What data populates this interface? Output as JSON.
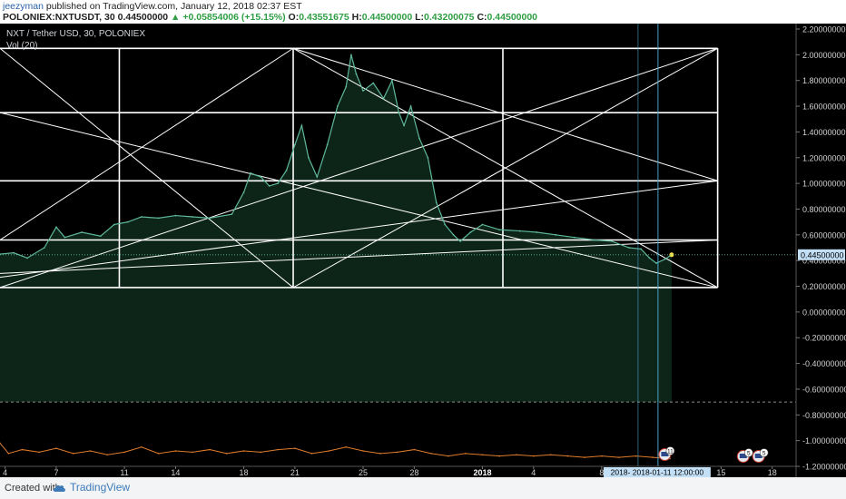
{
  "header": {
    "author": "jeezyman",
    "published_text": "published on TradingView.com, January 12, 2018 02:37 EST",
    "symbol_interval": "POLONIEX:NXTUSDT, 30",
    "price": "0.44500000",
    "change_arrow": "▲",
    "change": "+0.05854006 (+15.15%)",
    "o_label": "O:",
    "o_value": "0.43551675",
    "h_label": "H:",
    "h_value": "0.44500000",
    "l_label": "L:",
    "l_value": "0.43200075",
    "c_label": "C:",
    "c_value": "0.44500000"
  },
  "legend": {
    "title": "NXT / Tether USD, 30, POLONIEX",
    "vol": "Vol (20)"
  },
  "footer": {
    "created": "Created with",
    "brand": "TradingView"
  },
  "badges": {
    "flag_1": "11",
    "flag_2": "5",
    "flag_3": "5"
  },
  "colors": {
    "background": "#000000",
    "price_line": "#5fb89b",
    "drawing": "#ffffff",
    "volume": "#e07b2a",
    "price_tag": "#c3dff5",
    "crosshair": "#4aa3c8",
    "brand": "#3d7ab8"
  },
  "chart_data": {
    "type": "line",
    "title": "NXT / Tether USD, 30, POLONIEX",
    "ylim": [
      -1.2,
      2.2
    ],
    "yticks": [
      2.2,
      2.0,
      1.8,
      1.6,
      1.4,
      1.2,
      1.0,
      0.8,
      0.6,
      0.4,
      0.2,
      0.0,
      -0.2,
      -0.4,
      -0.6,
      -0.8,
      -1.0,
      -1.2
    ],
    "ytick_labels": [
      "2.20000000",
      "2.00000000",
      "1.80000000",
      "1.60000000",
      "1.40000000",
      "1.20000000",
      "1.00000000",
      "0.80000000",
      "0.60000000",
      "0.40000000",
      "0.20000000",
      "0.00000000",
      "-0.20000000",
      "-0.40000000",
      "-0.60000000",
      "-0.80000000",
      "-1.00000000",
      "-1.20000000"
    ],
    "xlim": [
      3.7,
      50.4
    ],
    "xticks": [
      {
        "x": 4,
        "label": "4"
      },
      {
        "x": 7,
        "label": "7"
      },
      {
        "x": 11,
        "label": "11"
      },
      {
        "x": 14,
        "label": "14"
      },
      {
        "x": 18,
        "label": "18"
      },
      {
        "x": 21,
        "label": "21"
      },
      {
        "x": 25,
        "label": "25"
      },
      {
        "x": 28,
        "label": "28"
      },
      {
        "x": 32,
        "label": "2018"
      },
      {
        "x": 35,
        "label": "4"
      },
      {
        "x": 39,
        "label": "8"
      },
      {
        "x": 46,
        "label": "15"
      },
      {
        "x": 49,
        "label": "18"
      }
    ],
    "x_unit": "day index from December 1, 2017 (32 = Jan 1, 2018)",
    "last_price_label": "0.44500000",
    "last_price": 0.445,
    "crosshair_label": "2018- 2018-01-11 12:00:00",
    "crosshair_x": 42.3,
    "series": [
      {
        "name": "NXT / Tether USD",
        "x": [
          3.7,
          4.5,
          5.3,
          6.3,
          7.0,
          7.5,
          8.5,
          9.6,
          10.4,
          11.2,
          12.0,
          13.0,
          14.0,
          15.0,
          16.0,
          17.3,
          18.0,
          18.4,
          19.0,
          19.5,
          20.0,
          20.5,
          21.0,
          21.4,
          21.8,
          22.3,
          22.9,
          23.5,
          24.0,
          24.3,
          24.6,
          25.0,
          25.6,
          26.2,
          26.7,
          27.1,
          27.4,
          27.8,
          28.3,
          28.8,
          29.3,
          29.8,
          30.3,
          30.7,
          31.3,
          32.0,
          33.0,
          34.2,
          35.2,
          36.3,
          37.4,
          38.6,
          39.6,
          40.6,
          41.3,
          41.8,
          42.2,
          42.7,
          43.1
        ],
        "values": [
          0.45,
          0.46,
          0.42,
          0.5,
          0.66,
          0.58,
          0.62,
          0.59,
          0.68,
          0.7,
          0.74,
          0.73,
          0.75,
          0.74,
          0.73,
          0.76,
          0.93,
          1.08,
          1.05,
          0.98,
          1.0,
          1.1,
          1.3,
          1.45,
          1.2,
          1.05,
          1.3,
          1.6,
          1.75,
          2.0,
          1.85,
          1.72,
          1.78,
          1.66,
          1.8,
          1.55,
          1.45,
          1.6,
          1.35,
          1.2,
          0.85,
          0.68,
          0.6,
          0.55,
          0.62,
          0.68,
          0.64,
          0.63,
          0.62,
          0.6,
          0.58,
          0.56,
          0.55,
          0.5,
          0.49,
          0.42,
          0.38,
          0.41,
          0.445
        ]
      },
      {
        "name": "Vol (20)",
        "x": [
          3.7,
          4.2,
          5.0,
          6.0,
          7.0,
          8.0,
          9.0,
          10.0,
          11.0,
          12.0,
          13.0,
          14.0,
          15.0,
          16.0,
          17.0,
          18.0,
          19.0,
          20.0,
          21.0,
          22.0,
          23.0,
          24.0,
          25.0,
          26.0,
          27.0,
          28.0,
          29.0,
          30.0,
          31.0,
          32.0,
          33.0,
          34.0,
          35.0,
          36.0,
          37.0,
          38.0,
          39.0,
          40.0,
          41.0,
          42.0,
          43.0
        ],
        "values": [
          -1.02,
          -1.1,
          -1.07,
          -1.09,
          -1.06,
          -1.1,
          -1.08,
          -1.11,
          -1.09,
          -1.05,
          -1.1,
          -1.08,
          -1.09,
          -1.07,
          -1.1,
          -1.08,
          -1.09,
          -1.07,
          -1.06,
          -1.1,
          -1.08,
          -1.05,
          -1.08,
          -1.1,
          -1.09,
          -1.07,
          -1.1,
          -1.12,
          -1.1,
          -1.11,
          -1.12,
          -1.11,
          -1.12,
          -1.11,
          -1.12,
          -1.13,
          -1.12,
          -1.13,
          -1.12,
          -1.13,
          -1.14
        ]
      }
    ],
    "drawings": {
      "hlines": [
        {
          "x0": 3.7,
          "x1": 45.8,
          "y": 2.05
        },
        {
          "x0": 3.7,
          "x1": 45.8,
          "y": 1.55
        },
        {
          "x0": 3.7,
          "x1": 45.8,
          "y": 1.02
        },
        {
          "x0": 3.7,
          "x1": 45.8,
          "y": 0.56
        },
        {
          "x0": 3.7,
          "x1": 45.8,
          "y": 0.19
        }
      ],
      "vlines": [
        {
          "x": 10.7,
          "y0": 0.19,
          "y1": 2.05
        },
        {
          "x": 20.9,
          "y0": 0.19,
          "y1": 2.05
        },
        {
          "x": 33.2,
          "y0": 0.19,
          "y1": 2.05
        },
        {
          "x": 45.8,
          "y0": 0.19,
          "y1": 2.05
        }
      ],
      "diagonals": [
        {
          "x0": 3.7,
          "y0": 2.05,
          "x1": 20.9,
          "y1": 0.19
        },
        {
          "x0": 3.7,
          "y0": 1.55,
          "x1": 45.8,
          "y1": 0.19
        },
        {
          "x0": 3.7,
          "y0": 0.19,
          "x1": 45.8,
          "y1": 2.05
        },
        {
          "x0": 3.7,
          "y0": 0.27,
          "x1": 45.8,
          "y1": 1.02
        },
        {
          "x0": 3.7,
          "y0": 0.56,
          "x1": 20.9,
          "y1": 2.05
        },
        {
          "x0": 20.9,
          "y0": 0.19,
          "x1": 45.8,
          "y1": 2.05
        },
        {
          "x0": 20.9,
          "y0": 2.05,
          "x1": 45.8,
          "y1": 1.02
        },
        {
          "x0": 20.9,
          "y0": 2.05,
          "x1": 45.8,
          "y1": 0.19
        },
        {
          "x0": 3.7,
          "y0": 0.3,
          "x1": 45.8,
          "y1": 0.56
        }
      ],
      "dashed_hline": -0.7
    },
    "grid": false
  }
}
